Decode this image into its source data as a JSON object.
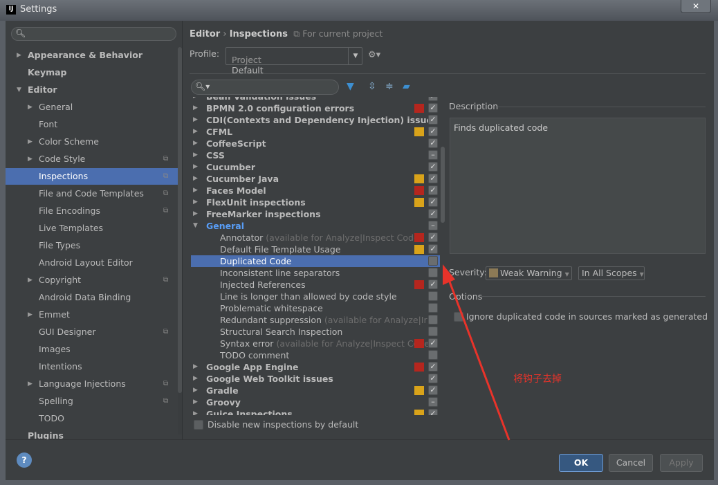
{
  "window": {
    "title": "Settings",
    "logo": "IJ",
    "close_icon": "close-icon"
  },
  "sidebar": {
    "search_placeholder": "",
    "items": [
      {
        "label": "Appearance & Behavior",
        "level": 0,
        "bold": true,
        "arrow": "right"
      },
      {
        "label": "Keymap",
        "level": 0,
        "bold": true
      },
      {
        "label": "Editor",
        "level": 0,
        "bold": true,
        "arrow": "down"
      },
      {
        "label": "General",
        "level": 1,
        "arrow": "right"
      },
      {
        "label": "Font",
        "level": 1
      },
      {
        "label": "Color Scheme",
        "level": 1,
        "arrow": "right"
      },
      {
        "label": "Code Style",
        "level": 1,
        "arrow": "right",
        "copy": true
      },
      {
        "label": "Inspections",
        "level": 1,
        "copy": true,
        "selected": true
      },
      {
        "label": "File and Code Templates",
        "level": 1,
        "copy": true
      },
      {
        "label": "File Encodings",
        "level": 1,
        "copy": true
      },
      {
        "label": "Live Templates",
        "level": 1
      },
      {
        "label": "File Types",
        "level": 1
      },
      {
        "label": "Android Layout Editor",
        "level": 1
      },
      {
        "label": "Copyright",
        "level": 1,
        "arrow": "right",
        "copy": true
      },
      {
        "label": "Android Data Binding",
        "level": 1
      },
      {
        "label": "Emmet",
        "level": 1,
        "arrow": "right"
      },
      {
        "label": "GUI Designer",
        "level": 1,
        "copy": true
      },
      {
        "label": "Images",
        "level": 1
      },
      {
        "label": "Intentions",
        "level": 1
      },
      {
        "label": "Language Injections",
        "level": 1,
        "arrow": "right",
        "copy": true
      },
      {
        "label": "Spelling",
        "level": 1,
        "copy": true
      },
      {
        "label": "TODO",
        "level": 1
      },
      {
        "label": "Plugins",
        "level": 0,
        "bold": true
      }
    ]
  },
  "breadcrumb": {
    "parent": "Editor",
    "separator": "›",
    "current": "Inspections",
    "scope": "For current project"
  },
  "profile": {
    "label": "Profile:",
    "value": "Project Default",
    "value_hint": "Project"
  },
  "tree": {
    "rows": [
      {
        "label": "Bean Validation issues",
        "level": 0,
        "arrow": "right",
        "check": "checked"
      },
      {
        "label": "BPMN 2.0 configuration errors",
        "level": 0,
        "arrow": "right",
        "severity": "#b5261e",
        "check": "checked"
      },
      {
        "label": "CDI(Contexts and Dependency Injection) issues",
        "level": 0,
        "arrow": "right",
        "check": "checked"
      },
      {
        "label": "CFML",
        "level": 0,
        "arrow": "right",
        "severity": "#d9a31a",
        "check": "checked"
      },
      {
        "label": "CoffeeScript",
        "level": 0,
        "arrow": "right",
        "check": "checked"
      },
      {
        "label": "CSS",
        "level": 0,
        "arrow": "right",
        "check": "partial"
      },
      {
        "label": "Cucumber",
        "level": 0,
        "arrow": "right",
        "check": "checked"
      },
      {
        "label": "Cucumber Java",
        "level": 0,
        "arrow": "right",
        "severity": "#d9a31a",
        "check": "checked"
      },
      {
        "label": "Faces Model",
        "level": 0,
        "arrow": "right",
        "severity": "#b5261e",
        "check": "checked"
      },
      {
        "label": "FlexUnit inspections",
        "level": 0,
        "arrow": "right",
        "severity": "#d9a31a",
        "check": "checked"
      },
      {
        "label": "FreeMarker inspections",
        "level": 0,
        "arrow": "right",
        "check": "checked"
      },
      {
        "label": "General",
        "level": 0,
        "arrow": "down",
        "check": "partial",
        "highlight": true
      },
      {
        "label": "Annotator",
        "hint": "(available for Analyze|Inspect Code)",
        "level": 1,
        "severity": "#b5261e",
        "check": "checked"
      },
      {
        "label": "Default File Template Usage",
        "level": 1,
        "severity": "#d9a31a",
        "check": "checked"
      },
      {
        "label": "Duplicated Code",
        "level": 1,
        "check": "unchecked",
        "selected": true
      },
      {
        "label": "Inconsistent line separators",
        "level": 1,
        "check": "unchecked"
      },
      {
        "label": "Injected References",
        "level": 1,
        "severity": "#b5261e",
        "check": "checked"
      },
      {
        "label": "Line is longer than allowed by code style",
        "level": 1,
        "check": "unchecked"
      },
      {
        "label": "Problematic whitespace",
        "level": 1,
        "check": "unchecked"
      },
      {
        "label": "Redundant suppression",
        "hint": "(available for Analyze|Ir",
        "level": 1,
        "check": "unchecked"
      },
      {
        "label": "Structural Search Inspection",
        "level": 1,
        "check": "unchecked"
      },
      {
        "label": "Syntax error",
        "hint": "(available for Analyze|Inspect Code",
        "level": 1,
        "severity": "#b5261e",
        "check": "checked"
      },
      {
        "label": "TODO comment",
        "level": 1,
        "check": "unchecked"
      },
      {
        "label": "Google App Engine",
        "level": 0,
        "arrow": "right",
        "severity": "#b5261e",
        "check": "checked"
      },
      {
        "label": "Google Web Toolkit issues",
        "level": 0,
        "arrow": "right",
        "check": "checked"
      },
      {
        "label": "Gradle",
        "level": 0,
        "arrow": "right",
        "severity": "#d9a31a",
        "check": "checked"
      },
      {
        "label": "Groovy",
        "level": 0,
        "arrow": "right",
        "check": "partial"
      },
      {
        "label": "Guice Inspections",
        "level": 0,
        "arrow": "right",
        "severity": "#d9a31a",
        "check": "checked"
      }
    ]
  },
  "disable_new": {
    "label": "Disable new inspections by default",
    "checked": false
  },
  "description": {
    "heading": "Description",
    "text": "Finds duplicated code"
  },
  "severity": {
    "label": "Severity:",
    "value": "Weak Warning",
    "color": "#8c7a56",
    "scope": "In All Scopes"
  },
  "options": {
    "heading": "Options",
    "ignore_generated": {
      "label": "Ignore duplicated code in sources marked as generated",
      "checked": false
    }
  },
  "annotation": {
    "text": "将钩子去掉",
    "color": "#e8332a"
  },
  "buttons": {
    "ok": "OK",
    "cancel": "Cancel",
    "apply": "Apply",
    "help": "?"
  }
}
